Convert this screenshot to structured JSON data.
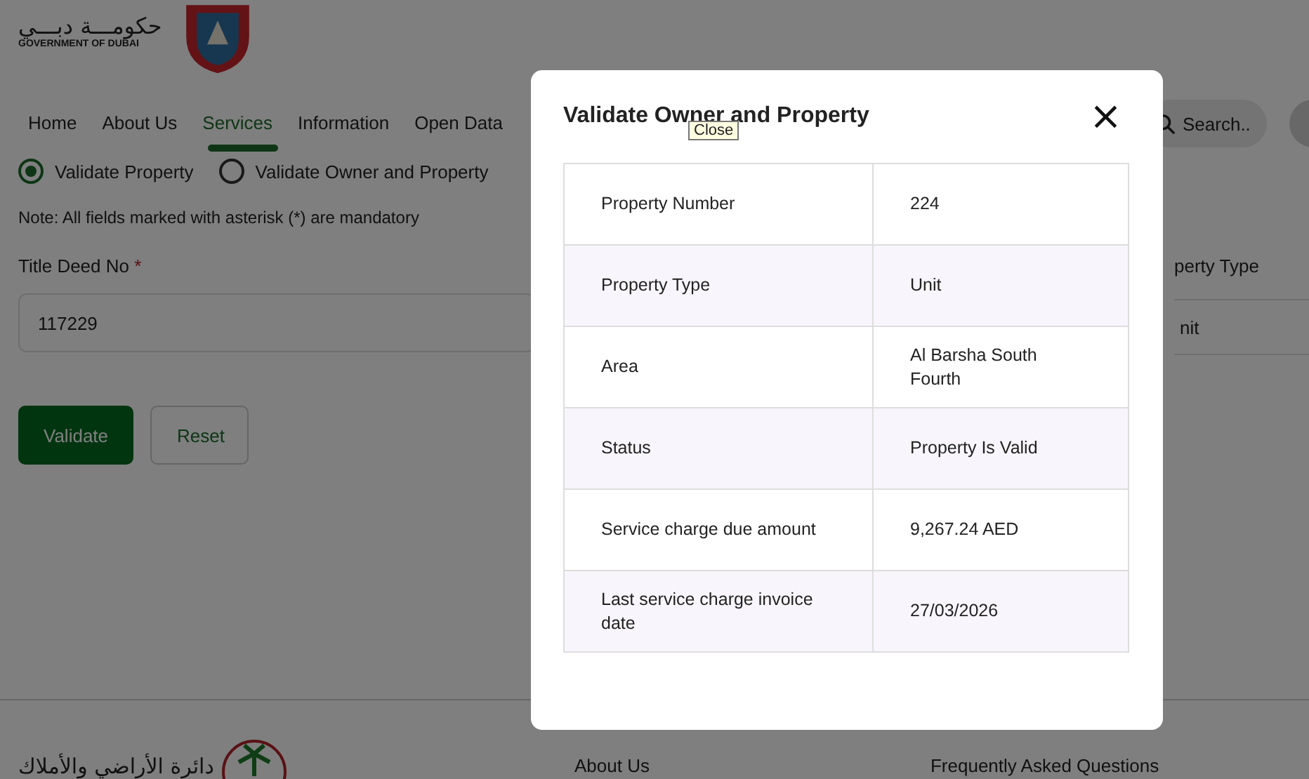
{
  "header": {
    "logo_arabic": "حكومـــة دبـــي",
    "logo_english": "GOVERNMENT OF DUBAI"
  },
  "nav": [
    {
      "label": "Home",
      "selected": false
    },
    {
      "label": "About Us",
      "selected": false
    },
    {
      "label": "Services",
      "selected": true
    },
    {
      "label": "Information",
      "selected": false
    },
    {
      "label": "Open Data",
      "selected": false
    }
  ],
  "search": {
    "placeholder": "Search.."
  },
  "radios": [
    {
      "label": "Validate Property",
      "selected": true
    },
    {
      "label": "Validate Owner and Property",
      "selected": false
    }
  ],
  "note": "Note: All fields marked with asterisk (*) are mandatory",
  "title_deed": {
    "label": "Title Deed No",
    "required_mark": "*",
    "value": "117229"
  },
  "property_type": {
    "label": "perty Type",
    "value": "nit"
  },
  "buttons": [
    {
      "label": "Validate",
      "kind": "primary"
    },
    {
      "label": "Reset",
      "kind": "secondary"
    }
  ],
  "footer": {
    "arabic": "دائرة الأراضي والأملاك",
    "links": [
      "About Us",
      "Frequently Asked Questions"
    ]
  },
  "modal": {
    "title": "Validate Owner and Property",
    "close": "×",
    "tooltip": "Close",
    "rows": [
      {
        "label": "Property Number",
        "value": "224"
      },
      {
        "label": "Property Type",
        "value": "Unit"
      },
      {
        "label": "Area",
        "value": "Al Barsha South Fourth"
      },
      {
        "label": "Status",
        "value": "Property Is Valid"
      },
      {
        "label": "Service charge due amount",
        "value": "9,267.24 AED"
      },
      {
        "label": "Last service charge invoice date",
        "value": "27/03/2026"
      }
    ]
  }
}
